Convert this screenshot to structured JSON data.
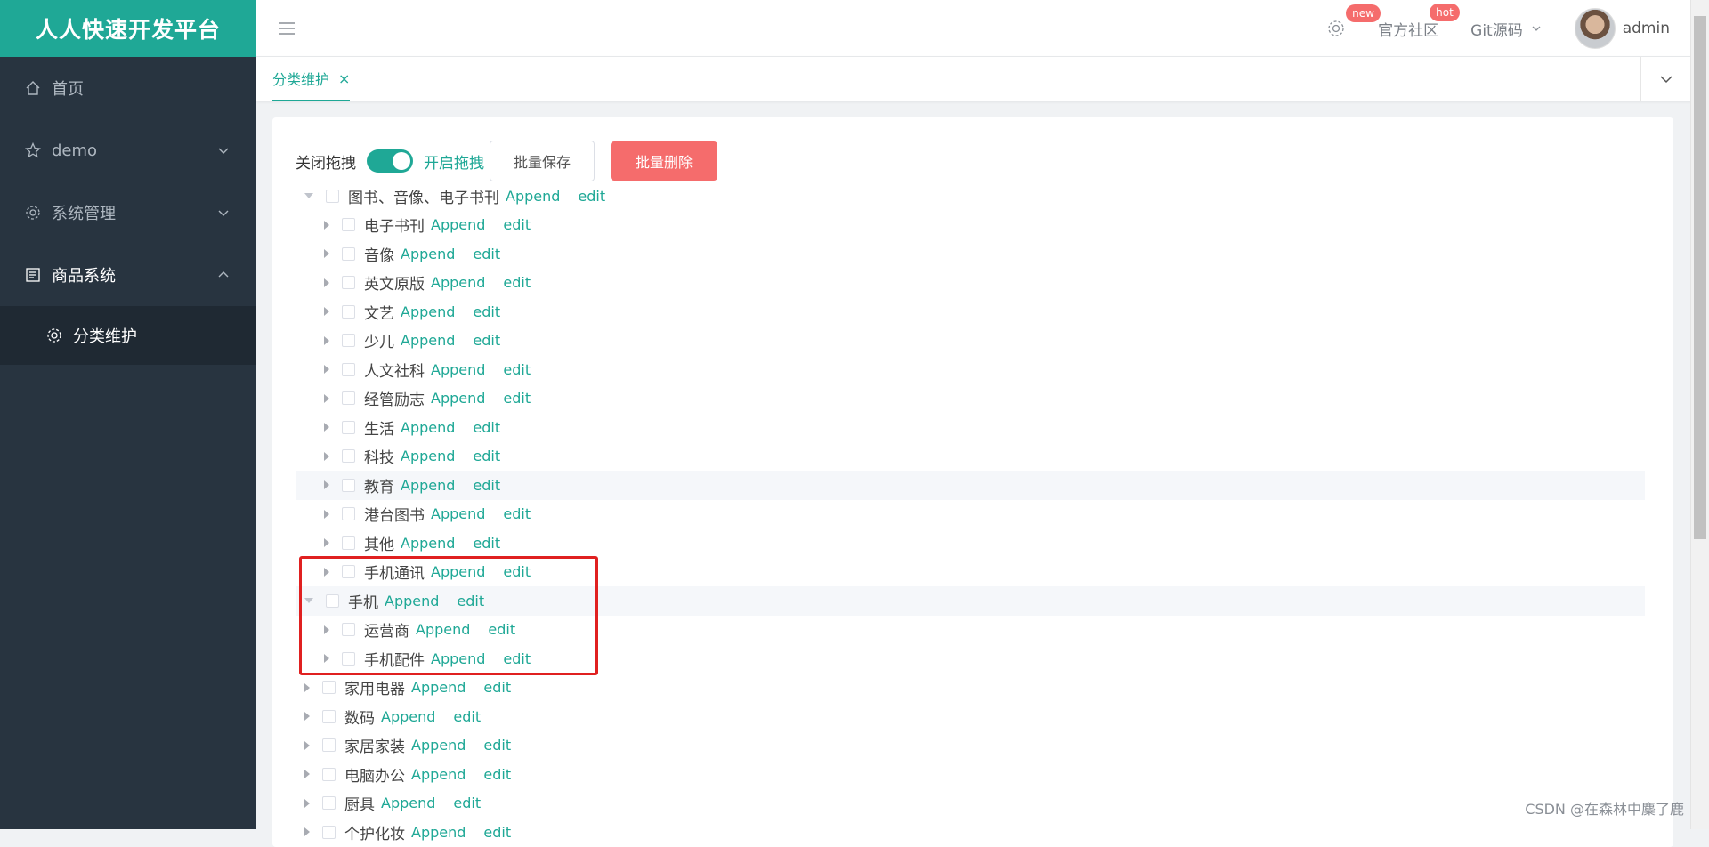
{
  "app": {
    "title": "人人快速开发平台"
  },
  "sidebar": {
    "items": [
      {
        "label": "首页",
        "icon": "home-icon"
      },
      {
        "label": "demo",
        "icon": "star-icon"
      },
      {
        "label": "系统管理",
        "icon": "gear-icon"
      },
      {
        "label": "商品系统",
        "icon": "product-icon"
      }
    ],
    "subitems": [
      {
        "label": "分类维护",
        "icon": "gear-icon"
      }
    ]
  },
  "topbar": {
    "settings_badge": "new",
    "community_label": "官方社区",
    "community_badge": "hot",
    "git_label": "Git源码",
    "user_name": "admin"
  },
  "tabs": [
    {
      "label": "分类维护",
      "close": "×"
    }
  ],
  "toolbar": {
    "drag_off_label": "关闭拖拽",
    "drag_on_label": "开启拖拽",
    "drag_enabled": true,
    "batch_save_label": "批量保存",
    "batch_delete_label": "批量删除"
  },
  "tree_actions": {
    "append": "Append",
    "edit": "edit"
  },
  "tree": [
    {
      "label": "图书、音像、电子书刊",
      "level": 0,
      "expanded": true
    },
    {
      "label": "电子书刊",
      "level": 1,
      "expanded": false
    },
    {
      "label": "音像",
      "level": 1,
      "expanded": false
    },
    {
      "label": "英文原版",
      "level": 1,
      "expanded": false
    },
    {
      "label": "文艺",
      "level": 1,
      "expanded": false
    },
    {
      "label": "少儿",
      "level": 1,
      "expanded": false
    },
    {
      "label": "人文社科",
      "level": 1,
      "expanded": false
    },
    {
      "label": "经管励志",
      "level": 1,
      "expanded": false
    },
    {
      "label": "生活",
      "level": 1,
      "expanded": false
    },
    {
      "label": "科技",
      "level": 1,
      "expanded": false
    },
    {
      "label": "教育",
      "level": 1,
      "expanded": false,
      "highlighted": true
    },
    {
      "label": "港台图书",
      "level": 1,
      "expanded": false
    },
    {
      "label": "其他",
      "level": 1,
      "expanded": false
    },
    {
      "label": "手机通讯",
      "level": 1,
      "expanded": false
    },
    {
      "label": "手机",
      "level": 0,
      "expanded": true,
      "highlighted": true
    },
    {
      "label": "运营商",
      "level": 1,
      "expanded": false
    },
    {
      "label": "手机配件",
      "level": 1,
      "expanded": false
    },
    {
      "label": "家用电器",
      "level": 0,
      "expanded": false
    },
    {
      "label": "数码",
      "level": 0,
      "expanded": false
    },
    {
      "label": "家居家装",
      "level": 0,
      "expanded": false
    },
    {
      "label": "电脑办公",
      "level": 0,
      "expanded": false
    },
    {
      "label": "厨具",
      "level": 0,
      "expanded": false
    },
    {
      "label": "个护化妆",
      "level": 0,
      "expanded": false
    }
  ],
  "watermark": "CSDN @在森林中麋了鹿",
  "colors": {
    "accent": "#1fa896",
    "sidebar": "#283440",
    "danger": "#f56c6c",
    "highlight_box": "#e02020"
  }
}
